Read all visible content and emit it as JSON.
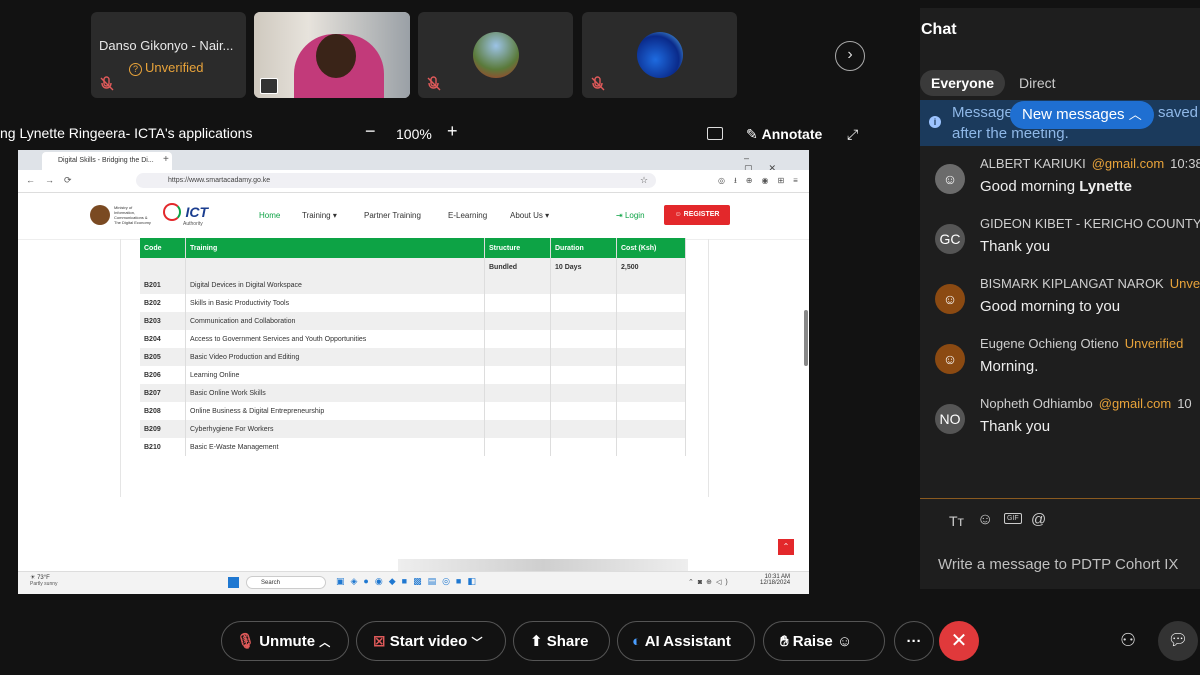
{
  "participants": [
    {
      "name": "Danso Gikonyo - Nair...",
      "status": "Unverified",
      "muted": true
    },
    {
      "name": "",
      "status": "",
      "sharing": true
    },
    {
      "name": "",
      "status": "",
      "muted": true
    },
    {
      "name": "",
      "status": "",
      "muted": true
    }
  ],
  "share_bar": {
    "title": "ng Lynette Ringeera- ICTA's applications",
    "zoom": "100%",
    "annotate": "Annotate"
  },
  "browser": {
    "tab_title": "Digital Skills - Bridging the Di...",
    "url": "https://www.smartacadamy.go.ke",
    "nav": [
      "Home",
      "Training",
      "Partner Training",
      "E-Learning",
      "About Us"
    ],
    "login": "Login",
    "register": "REGISTER",
    "logo_text": "ICT",
    "logo_sub": "Authority",
    "gov_text": "Ministry of Information, Communications & The Digital Economy"
  },
  "training_table": {
    "headers": [
      "Code",
      "Training",
      "Structure",
      "Duration",
      "Cost (Ksh)"
    ],
    "summary": [
      "",
      "",
      "Bundled",
      "10 Days",
      "2,500"
    ],
    "rows": [
      [
        "B201",
        "Digital Devices in Digital Workspace"
      ],
      [
        "B202",
        "Skills in Basic Productivity Tools"
      ],
      [
        "B203",
        "Communication and Collaboration"
      ],
      [
        "B204",
        "Access to Government Services and Youth Opportunities"
      ],
      [
        "B205",
        "Basic Video Production and Editing"
      ],
      [
        "B206",
        "Learning Online"
      ],
      [
        "B207",
        "Basic Online Work Skills"
      ],
      [
        "B208",
        "Online Business & Digital Entrepreneurship"
      ],
      [
        "B209",
        "Cyberhygiene For Workers"
      ],
      [
        "B210",
        "Basic E-Waste Management"
      ]
    ]
  },
  "taskbar": {
    "weather": "73°F",
    "weather_sub": "Partly sunny",
    "search": "Search",
    "time": "10:31 AM",
    "date": "12/18/2024"
  },
  "chat": {
    "title": "Chat",
    "tabs": [
      "Everyone",
      "Direct"
    ],
    "notice_left": "Message",
    "notice_right": "saved",
    "notice_line2": "after the meeting.",
    "new_messages": "New messages",
    "messages": [
      {
        "initials": "",
        "sender": "ALBERT KARIUKI",
        "tag": "@gmail.com",
        "time": "10:38",
        "text": "Good morning ",
        "bold": "Lynette",
        "avatar_color": "#6b6b6b"
      },
      {
        "initials": "GC",
        "sender": "GIDEON KIBET - KERICHO COUNTY",
        "tag": "",
        "time": "",
        "text": "Thank you",
        "bold": "",
        "avatar_color": "#555555"
      },
      {
        "initials": "",
        "sender": "BISMARK KIPLANGAT NAROK",
        "tag": "Unver",
        "time": "",
        "text": "Good morning to you",
        "bold": "",
        "avatar_color": "#8b4a12"
      },
      {
        "initials": "",
        "sender": "Eugene Ochieng Otieno",
        "tag": "Unverified",
        "time": "",
        "text": "Morning.",
        "bold": "",
        "avatar_color": "#8b4a12"
      },
      {
        "initials": "NO",
        "sender": "Nopheth Odhiambo",
        "tag": "@gmail.com",
        "time": "10",
        "text": "Thank you",
        "bold": "",
        "avatar_color": "#555555"
      }
    ],
    "composer_placeholder": "Write a message to PDTP Cohort IX"
  },
  "controls": {
    "unmute": "Unmute",
    "start_video": "Start video",
    "share": "Share",
    "ai_assistant": "AI Assistant",
    "raise": "Raise",
    "more": "···"
  },
  "colors": {
    "accent_blue": "#1f6fd1",
    "warning_orange": "#e8a33a",
    "end_red": "#e0393b",
    "table_green": "#0da345"
  }
}
